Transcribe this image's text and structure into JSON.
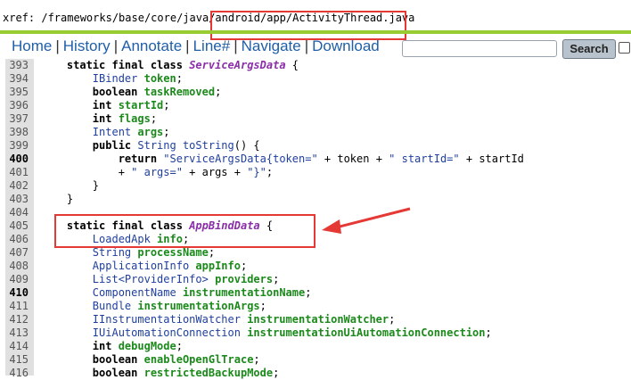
{
  "xref": {
    "label": "xref: /frameworks/base/core/java/",
    "path": "android/app/ActivityThread.java"
  },
  "nav": {
    "links": [
      "Home",
      "History",
      "Annotate",
      "Line#",
      "Navigate",
      "Download"
    ],
    "search_label": "Search"
  },
  "colors": {
    "accent_green": "#99cc33",
    "link_blue": "#1f5fa8",
    "highlight_red": "#e53935"
  },
  "code_lines": [
    {
      "n": "393",
      "bold": false,
      "tokens": [
        [
          "    ",
          ""
        ],
        [
          "static final class ",
          "kw"
        ],
        [
          "ServiceArgsData",
          "cls"
        ],
        [
          " {",
          "op"
        ]
      ]
    },
    {
      "n": "394",
      "bold": false,
      "tokens": [
        [
          "        ",
          ""
        ],
        [
          "IBinder ",
          "typ"
        ],
        [
          "token",
          "fld"
        ],
        [
          ";",
          "op"
        ]
      ]
    },
    {
      "n": "395",
      "bold": false,
      "tokens": [
        [
          "        ",
          ""
        ],
        [
          "boolean ",
          "kw"
        ],
        [
          "taskRemoved",
          "fld"
        ],
        [
          ";",
          "op"
        ]
      ]
    },
    {
      "n": "396",
      "bold": false,
      "tokens": [
        [
          "        ",
          ""
        ],
        [
          "int ",
          "kw"
        ],
        [
          "startId",
          "fld"
        ],
        [
          ";",
          "op"
        ]
      ]
    },
    {
      "n": "397",
      "bold": false,
      "tokens": [
        [
          "        ",
          ""
        ],
        [
          "int ",
          "kw"
        ],
        [
          "flags",
          "fld"
        ],
        [
          ";",
          "op"
        ]
      ]
    },
    {
      "n": "398",
      "bold": false,
      "tokens": [
        [
          "        ",
          ""
        ],
        [
          "Intent ",
          "typ"
        ],
        [
          "args",
          "fld"
        ],
        [
          ";",
          "op"
        ]
      ]
    },
    {
      "n": "399",
      "bold": false,
      "tokens": [
        [
          "        ",
          ""
        ],
        [
          "public ",
          "kw"
        ],
        [
          "String ",
          "typ"
        ],
        [
          "toString",
          "meth"
        ],
        [
          "() {",
          "op"
        ]
      ]
    },
    {
      "n": "400",
      "bold": true,
      "tokens": [
        [
          "            ",
          ""
        ],
        [
          "return ",
          "kw"
        ],
        [
          "\"ServiceArgsData{token=\"",
          "str"
        ],
        [
          " + token + ",
          "op"
        ],
        [
          "\" startId=\"",
          "str"
        ],
        [
          " + startId",
          "op"
        ]
      ]
    },
    {
      "n": "401",
      "bold": false,
      "tokens": [
        [
          "            ",
          ""
        ],
        [
          "+ ",
          "op"
        ],
        [
          "\" args=\"",
          "str"
        ],
        [
          " + args + ",
          "op"
        ],
        [
          "\"}\"",
          "str"
        ],
        [
          ";",
          "op"
        ]
      ]
    },
    {
      "n": "402",
      "bold": false,
      "tokens": [
        [
          "        ",
          ""
        ],
        [
          "}",
          "op"
        ]
      ]
    },
    {
      "n": "403",
      "bold": false,
      "tokens": [
        [
          "    ",
          ""
        ],
        [
          "}",
          "op"
        ]
      ]
    },
    {
      "n": "404",
      "bold": false,
      "tokens": [
        [
          "",
          ""
        ]
      ]
    },
    {
      "n": "405",
      "bold": false,
      "tokens": [
        [
          "    ",
          ""
        ],
        [
          "static final class ",
          "kw"
        ],
        [
          "AppBindData",
          "cls"
        ],
        [
          " {",
          "op"
        ]
      ]
    },
    {
      "n": "406",
      "bold": false,
      "tokens": [
        [
          "        ",
          ""
        ],
        [
          "LoadedApk ",
          "typ"
        ],
        [
          "info",
          "fld"
        ],
        [
          ";",
          "op"
        ]
      ]
    },
    {
      "n": "407",
      "bold": false,
      "tokens": [
        [
          "        ",
          ""
        ],
        [
          "String ",
          "typ"
        ],
        [
          "processName",
          "fld"
        ],
        [
          ";",
          "op"
        ]
      ]
    },
    {
      "n": "408",
      "bold": false,
      "tokens": [
        [
          "        ",
          ""
        ],
        [
          "ApplicationInfo ",
          "typ"
        ],
        [
          "appInfo",
          "fld"
        ],
        [
          ";",
          "op"
        ]
      ]
    },
    {
      "n": "409",
      "bold": false,
      "tokens": [
        [
          "        ",
          ""
        ],
        [
          "List<ProviderInfo> ",
          "typ"
        ],
        [
          "providers",
          "fld"
        ],
        [
          ";",
          "op"
        ]
      ]
    },
    {
      "n": "410",
      "bold": true,
      "tokens": [
        [
          "        ",
          ""
        ],
        [
          "ComponentName ",
          "typ"
        ],
        [
          "instrumentationName",
          "fld"
        ],
        [
          ";",
          "op"
        ]
      ]
    },
    {
      "n": "411",
      "bold": false,
      "tokens": [
        [
          "        ",
          ""
        ],
        [
          "Bundle ",
          "typ"
        ],
        [
          "instrumentationArgs",
          "fld"
        ],
        [
          ";",
          "op"
        ]
      ]
    },
    {
      "n": "412",
      "bold": false,
      "tokens": [
        [
          "        ",
          ""
        ],
        [
          "IInstrumentationWatcher ",
          "typ"
        ],
        [
          "instrumentationWatcher",
          "fld"
        ],
        [
          ";",
          "op"
        ]
      ]
    },
    {
      "n": "413",
      "bold": false,
      "tokens": [
        [
          "        ",
          ""
        ],
        [
          "IUiAutomationConnection ",
          "typ"
        ],
        [
          "instrumentationUiAutomationConnection",
          "fld"
        ],
        [
          ";",
          "op"
        ]
      ]
    },
    {
      "n": "414",
      "bold": false,
      "tokens": [
        [
          "        ",
          ""
        ],
        [
          "int ",
          "kw"
        ],
        [
          "debugMode",
          "fld"
        ],
        [
          ";",
          "op"
        ]
      ]
    },
    {
      "n": "415",
      "bold": false,
      "tokens": [
        [
          "        ",
          ""
        ],
        [
          "boolean ",
          "kw"
        ],
        [
          "enableOpenGlTrace",
          "fld"
        ],
        [
          ";",
          "op"
        ]
      ]
    },
    {
      "n": "416",
      "bold": false,
      "tokens": [
        [
          "        ",
          ""
        ],
        [
          "boolean ",
          "kw"
        ],
        [
          "restrictedBackupMode",
          "fld"
        ],
        [
          ";",
          "op"
        ]
      ]
    }
  ]
}
